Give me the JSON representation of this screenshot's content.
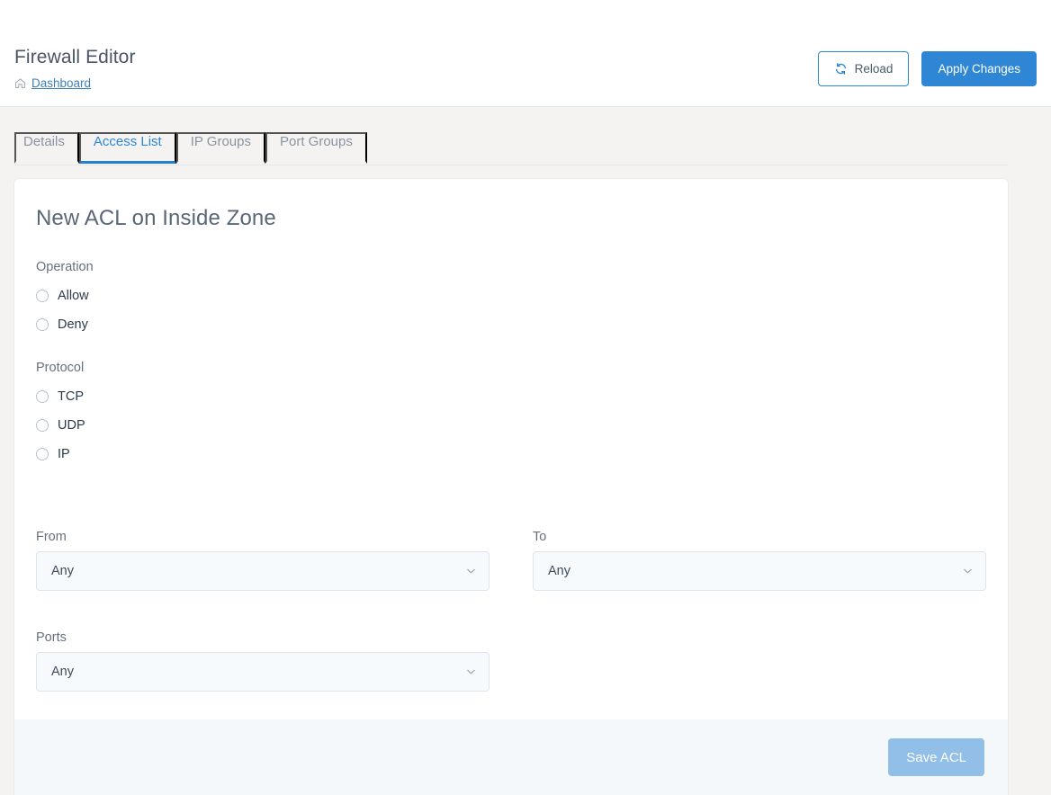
{
  "header": {
    "title": "Firewall Editor",
    "home_icon": "home-icon",
    "breadcrumb": "Dashboard",
    "reload_label": "Reload",
    "reload_icon": "sync-icon",
    "apply_label": "Apply Changes"
  },
  "tabs": [
    {
      "label": "Details",
      "active": false
    },
    {
      "label": "Access List",
      "active": true
    },
    {
      "label": "IP Groups",
      "active": false
    },
    {
      "label": "Port Groups",
      "active": false
    }
  ],
  "form": {
    "title": "New ACL on Inside Zone",
    "operation": {
      "label": "Operation",
      "options": [
        {
          "label": "Allow",
          "selected": false
        },
        {
          "label": "Deny",
          "selected": false
        }
      ]
    },
    "protocol": {
      "label": "Protocol",
      "options": [
        {
          "label": "TCP",
          "selected": false
        },
        {
          "label": "UDP",
          "selected": false
        },
        {
          "label": "IP",
          "selected": false
        }
      ]
    },
    "from": {
      "label": "From",
      "value": "Any",
      "icon": "chevron-down-icon"
    },
    "to": {
      "label": "To",
      "value": "Any",
      "icon": "chevron-down-icon"
    },
    "ports": {
      "label": "Ports",
      "value": "Any",
      "icon": "chevron-down-icon"
    }
  },
  "footer": {
    "save_label": "Save ACL"
  },
  "colors": {
    "accent": "#2e86d4",
    "tab_active": "#2680d0",
    "page_bg": "#f4f3f2",
    "footer_bg": "#f4f8fb",
    "save_disabled": "#92bfe8",
    "link": "#3f7fb8"
  }
}
